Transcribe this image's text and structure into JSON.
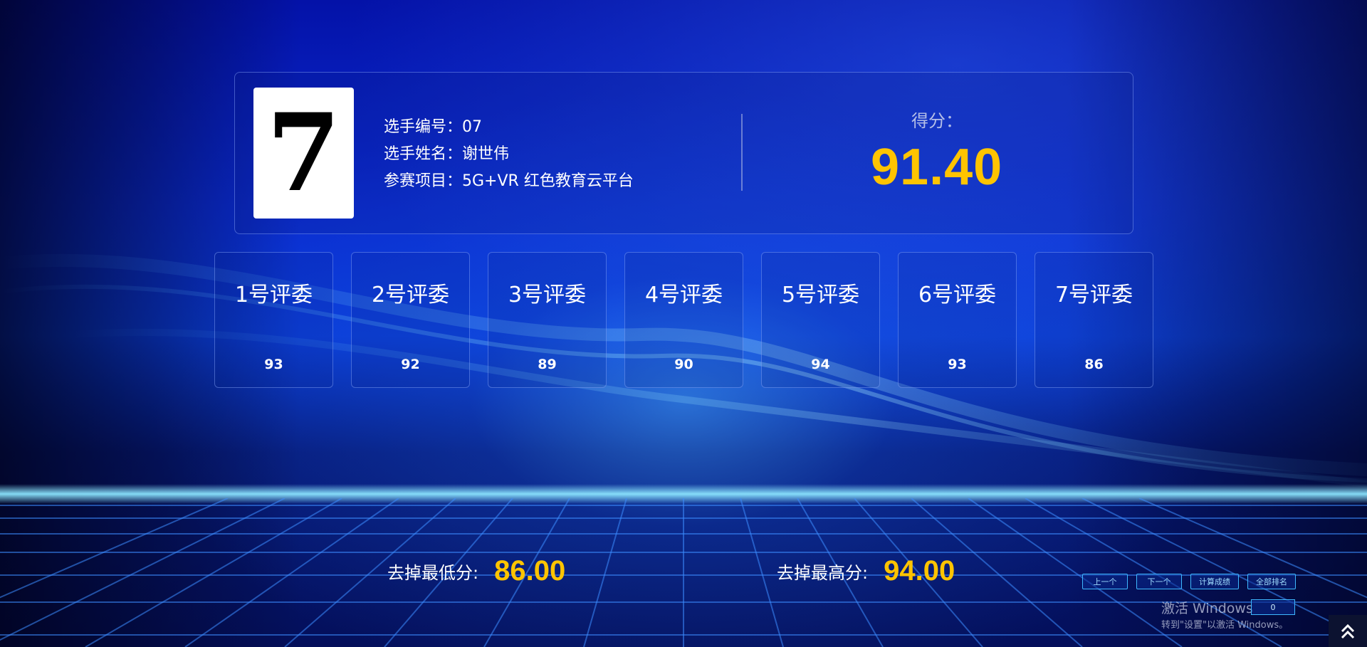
{
  "player": {
    "big_number": "7",
    "id_label": "选手编号：",
    "id_value": "07",
    "name_label": "选手姓名：",
    "name_value": "谢世伟",
    "project_label": "参赛项目：",
    "project_value": "5G+VR 红色教育云平台"
  },
  "score": {
    "label": "得分：",
    "value": "91.40"
  },
  "judges": [
    {
      "title": "1号评委",
      "score": "93"
    },
    {
      "title": "2号评委",
      "score": "92"
    },
    {
      "title": "3号评委",
      "score": "89"
    },
    {
      "title": "4号评委",
      "score": "90"
    },
    {
      "title": "5号评委",
      "score": "94"
    },
    {
      "title": "6号评委",
      "score": "93"
    },
    {
      "title": "7号评委",
      "score": "86"
    }
  ],
  "dropped": {
    "min_label": "去掉最低分:",
    "min_value": "86.00",
    "max_label": "去掉最高分:",
    "max_value": "94.00"
  },
  "controls": {
    "prev": "上一个",
    "next": "下一个",
    "calc": "计算成绩",
    "rank": "全部排名",
    "counter": "0"
  },
  "watermark": {
    "title": "激活 Windows",
    "subtitle": "转到\"设置\"以激活 Windows。"
  },
  "colors": {
    "accent": "#ffc400",
    "button_border": "#3fb8ff"
  }
}
